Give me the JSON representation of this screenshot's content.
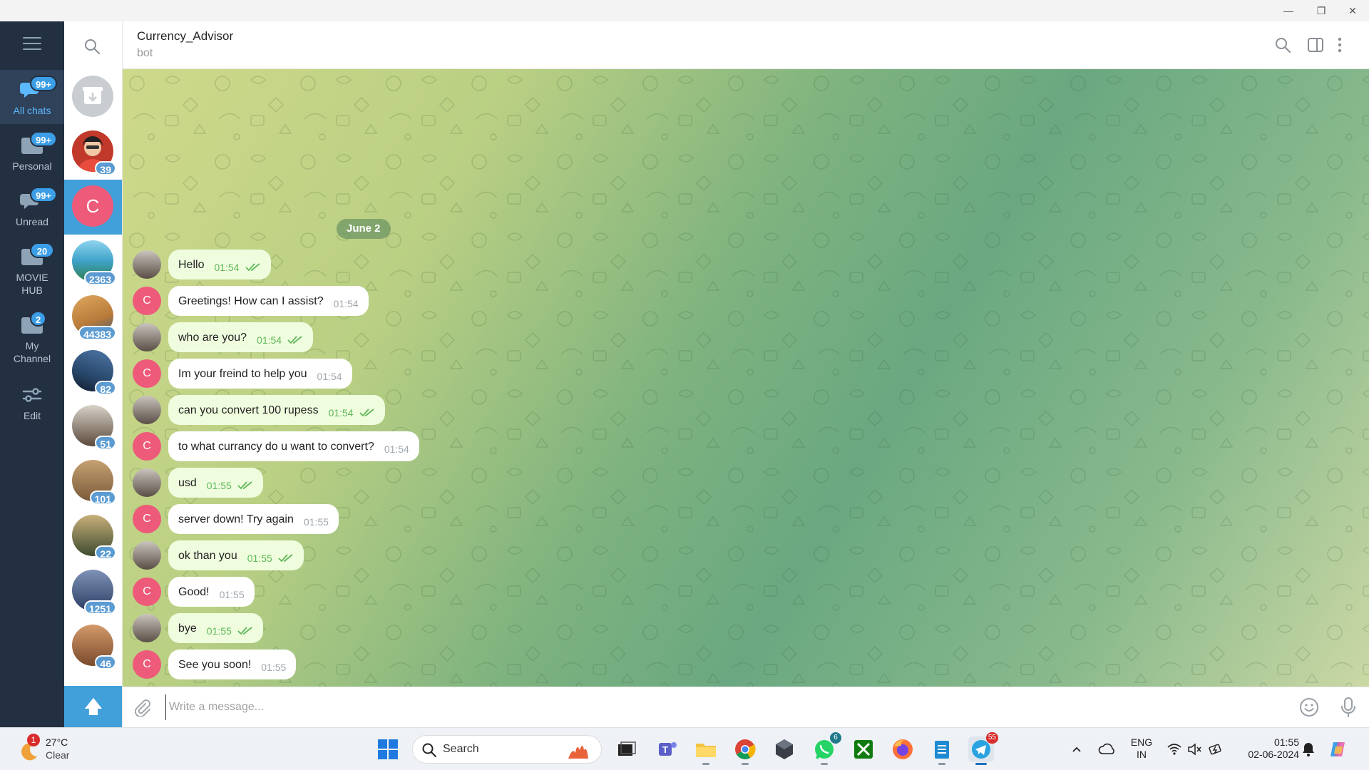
{
  "window": {
    "minimize_glyph": "—",
    "maximize_glyph": "❐",
    "close_glyph": "✕"
  },
  "folders": [
    {
      "label": "All chats",
      "badge": "99+",
      "icon": "chats-icon",
      "active": true
    },
    {
      "label": "Personal",
      "badge": "99+",
      "icon": "folder-icon",
      "active": false
    },
    {
      "label": "Unread",
      "badge": "99+",
      "icon": "chats-icon",
      "active": false
    },
    {
      "label": "MOVIE HUB",
      "badge": "20",
      "icon": "folder-icon",
      "active": false
    },
    {
      "label": "My Channel",
      "badge": "2",
      "icon": "folder-icon",
      "active": false
    },
    {
      "label": "Edit",
      "badge": "",
      "icon": "sliders-icon",
      "active": false
    }
  ],
  "chatlist": {
    "items": [
      {
        "kind": "archive",
        "badge": ""
      },
      {
        "kind": "avatar",
        "badge": "39",
        "color": "#c0392b"
      },
      {
        "kind": "letter",
        "letter": "C",
        "badge": "",
        "active": true
      },
      {
        "kind": "avatar",
        "badge": "2363",
        "color": "#3fa3c9"
      },
      {
        "kind": "avatar",
        "badge": "44383",
        "color": "#b77a3a"
      },
      {
        "kind": "avatar",
        "badge": "82",
        "color": "#28476b"
      },
      {
        "kind": "avatar",
        "badge": "51",
        "color": "#5b4a3c"
      },
      {
        "kind": "avatar",
        "badge": "101",
        "color": "#7a5a3a"
      },
      {
        "kind": "avatar",
        "badge": "22",
        "color": "#3e4a2f"
      },
      {
        "kind": "avatar",
        "badge": "1251",
        "color": "#2c3e63"
      },
      {
        "kind": "avatar",
        "badge": "46",
        "color": "#7a4a2c"
      }
    ],
    "scroll_up_glyph": "🡅"
  },
  "header": {
    "title": "Currency_Advisor",
    "subtitle": "bot"
  },
  "date_pill": "June 2",
  "messages": [
    {
      "dir": "out",
      "text": "Hello",
      "time": "01:54"
    },
    {
      "dir": "in",
      "text": "Greetings! How can I assist?",
      "time": "01:54"
    },
    {
      "dir": "out",
      "text": "who are you?",
      "time": "01:54"
    },
    {
      "dir": "in",
      "text": "Im your freind to help you",
      "time": "01:54"
    },
    {
      "dir": "out",
      "text": "can you convert 100 rupess",
      "time": "01:54"
    },
    {
      "dir": "in",
      "text": "to what currancy do u want to convert?",
      "time": "01:54"
    },
    {
      "dir": "out",
      "text": "usd",
      "time": "01:55"
    },
    {
      "dir": "in",
      "text": "server down! Try again",
      "time": "01:55"
    },
    {
      "dir": "out",
      "text": "ok than you",
      "time": "01:55"
    },
    {
      "dir": "in",
      "text": "Good!",
      "time": "01:55"
    },
    {
      "dir": "out",
      "text": "bye",
      "time": "01:55"
    },
    {
      "dir": "in",
      "text": "See you soon!",
      "time": "01:55"
    }
  ],
  "bot_avatar_letter": "C",
  "composer": {
    "placeholder": "Write a message..."
  },
  "taskbar": {
    "weather_temp": "27°C",
    "weather_cond": "Clear",
    "weather_badge": "1",
    "search_label": "Search",
    "apps": [
      {
        "name": "start",
        "badge": ""
      },
      {
        "name": "task-view",
        "badge": ""
      },
      {
        "name": "teams",
        "badge": ""
      },
      {
        "name": "file-explorer",
        "badge": ""
      },
      {
        "name": "chrome",
        "badge": ""
      },
      {
        "name": "app-cube",
        "badge": ""
      },
      {
        "name": "whatsapp",
        "badge": "6"
      },
      {
        "name": "xbox",
        "badge": ""
      },
      {
        "name": "firefox",
        "badge": ""
      },
      {
        "name": "notepad",
        "badge": ""
      },
      {
        "name": "telegram",
        "badge": "55"
      }
    ],
    "lang_top": "ENG",
    "lang_bottom": "IN",
    "time": "01:55",
    "date": "02-06-2024"
  },
  "colors": {
    "accent": "#419fd9",
    "sidebar": "#223042",
    "out_bubble": "#effdde",
    "in_bubble": "#ffffff",
    "bot_avatar": "#ee5a7a"
  }
}
